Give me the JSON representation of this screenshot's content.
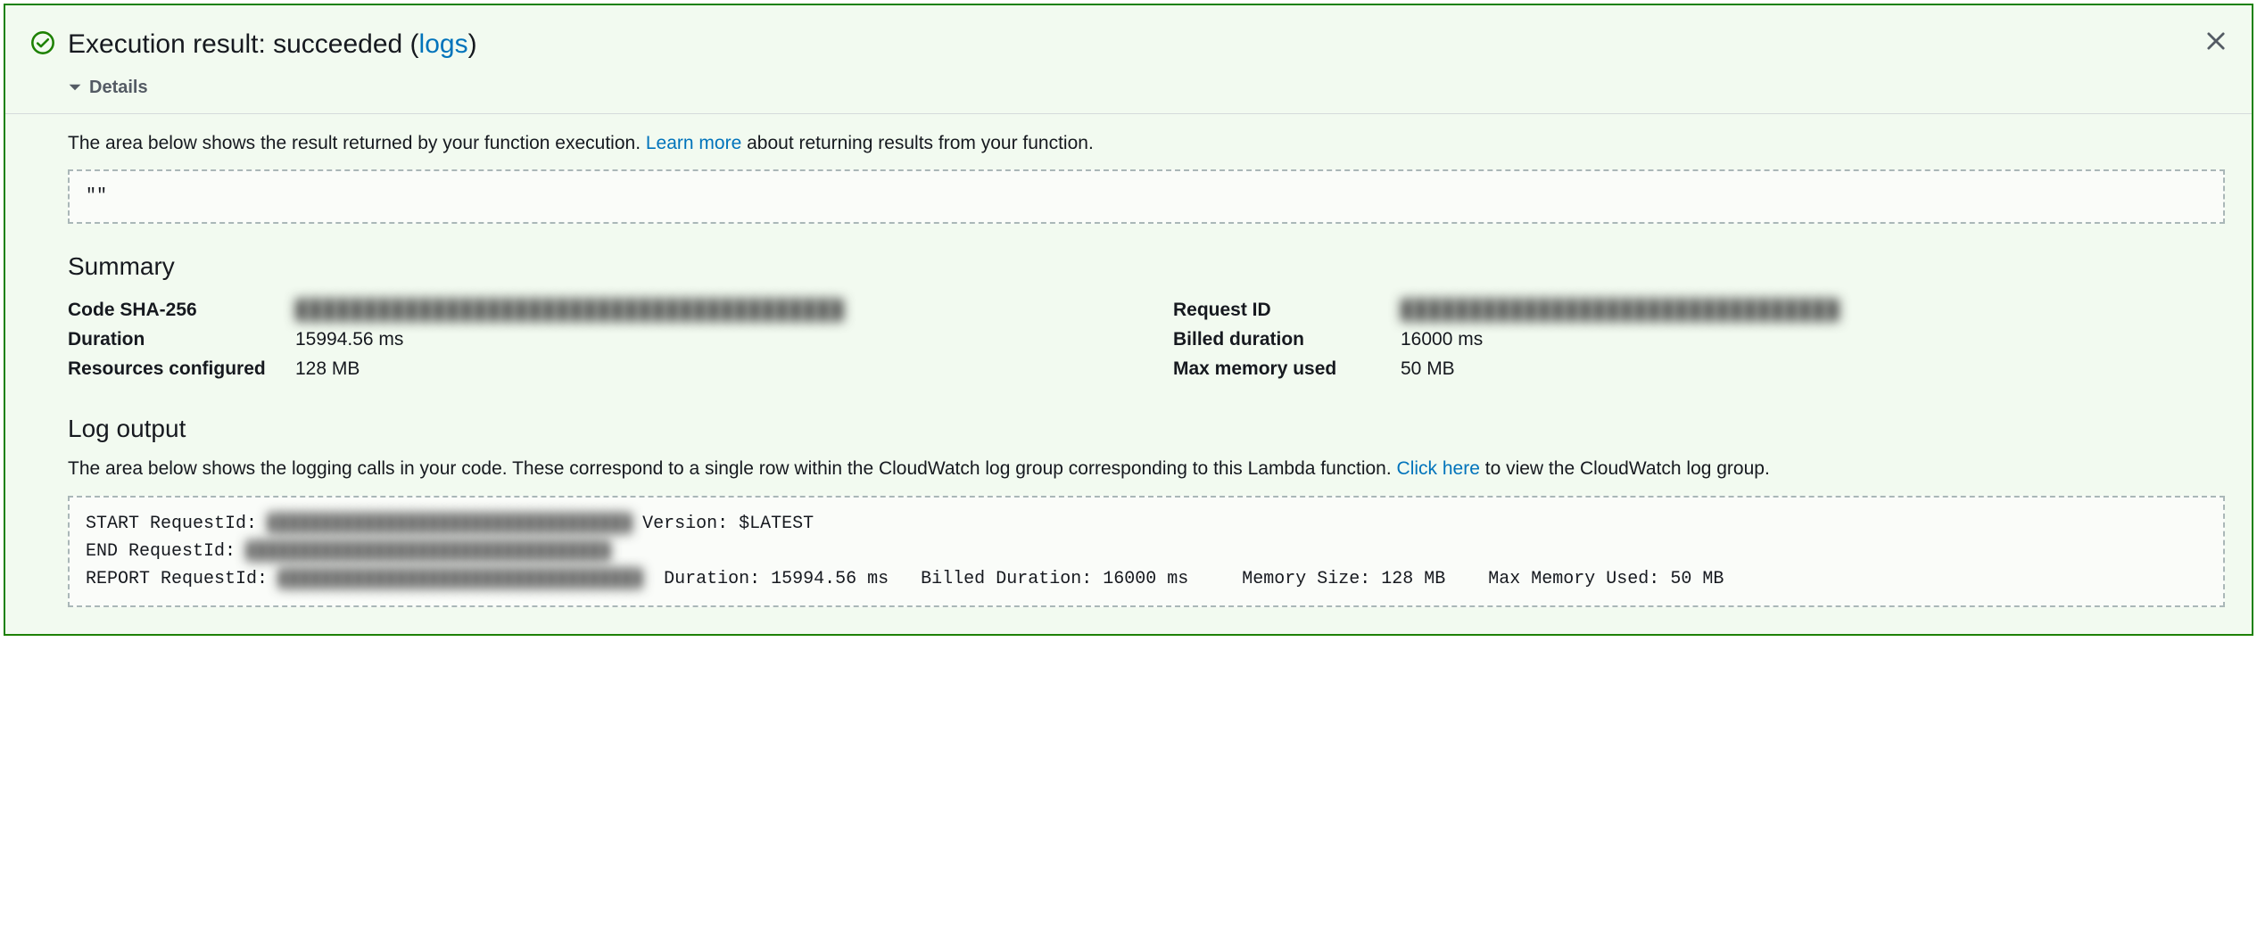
{
  "header": {
    "title_prefix": "Execution result: succeeded (",
    "logs_link": "logs",
    "title_suffix": ")"
  },
  "details_label": "Details",
  "result": {
    "desc_prefix": "The area below shows the result returned by your function execution. ",
    "learn_more": "Learn more",
    "desc_suffix": " about returning results from your function.",
    "return_value": "\"\""
  },
  "summary": {
    "title": "Summary",
    "left": [
      {
        "k": "Code SHA-256",
        "v": "████████████████████████████████████████",
        "blur": true
      },
      {
        "k": "Duration",
        "v": "15994.56 ms",
        "blur": false
      },
      {
        "k": "Resources configured",
        "v": "128 MB",
        "blur": false
      }
    ],
    "right": [
      {
        "k": "Request ID",
        "v": "████████████████████████████████",
        "blur": true
      },
      {
        "k": "Billed duration",
        "v": "16000 ms",
        "blur": false
      },
      {
        "k": "Max memory used",
        "v": "50 MB",
        "blur": false
      }
    ]
  },
  "log": {
    "title": "Log output",
    "desc_prefix": "The area below shows the logging calls in your code. These correspond to a single row within the CloudWatch log group corresponding to this Lambda function. ",
    "click_here": "Click here",
    "desc_suffix": " to view the CloudWatch log group.",
    "lines": {
      "l1a": "START RequestId: ",
      "l1b": "██████████████████████████████████",
      "l1c": " Version: $LATEST",
      "l2a": "END RequestId: ",
      "l2b": "██████████████████████████████████",
      "l3a": "REPORT RequestId: ",
      "l3b": "██████████████████████████████████",
      "l3c": "  Duration: 15994.56 ms   Billed Duration: 16000 ms     Memory Size: 128 MB    Max Memory Used: 50 MB"
    }
  }
}
